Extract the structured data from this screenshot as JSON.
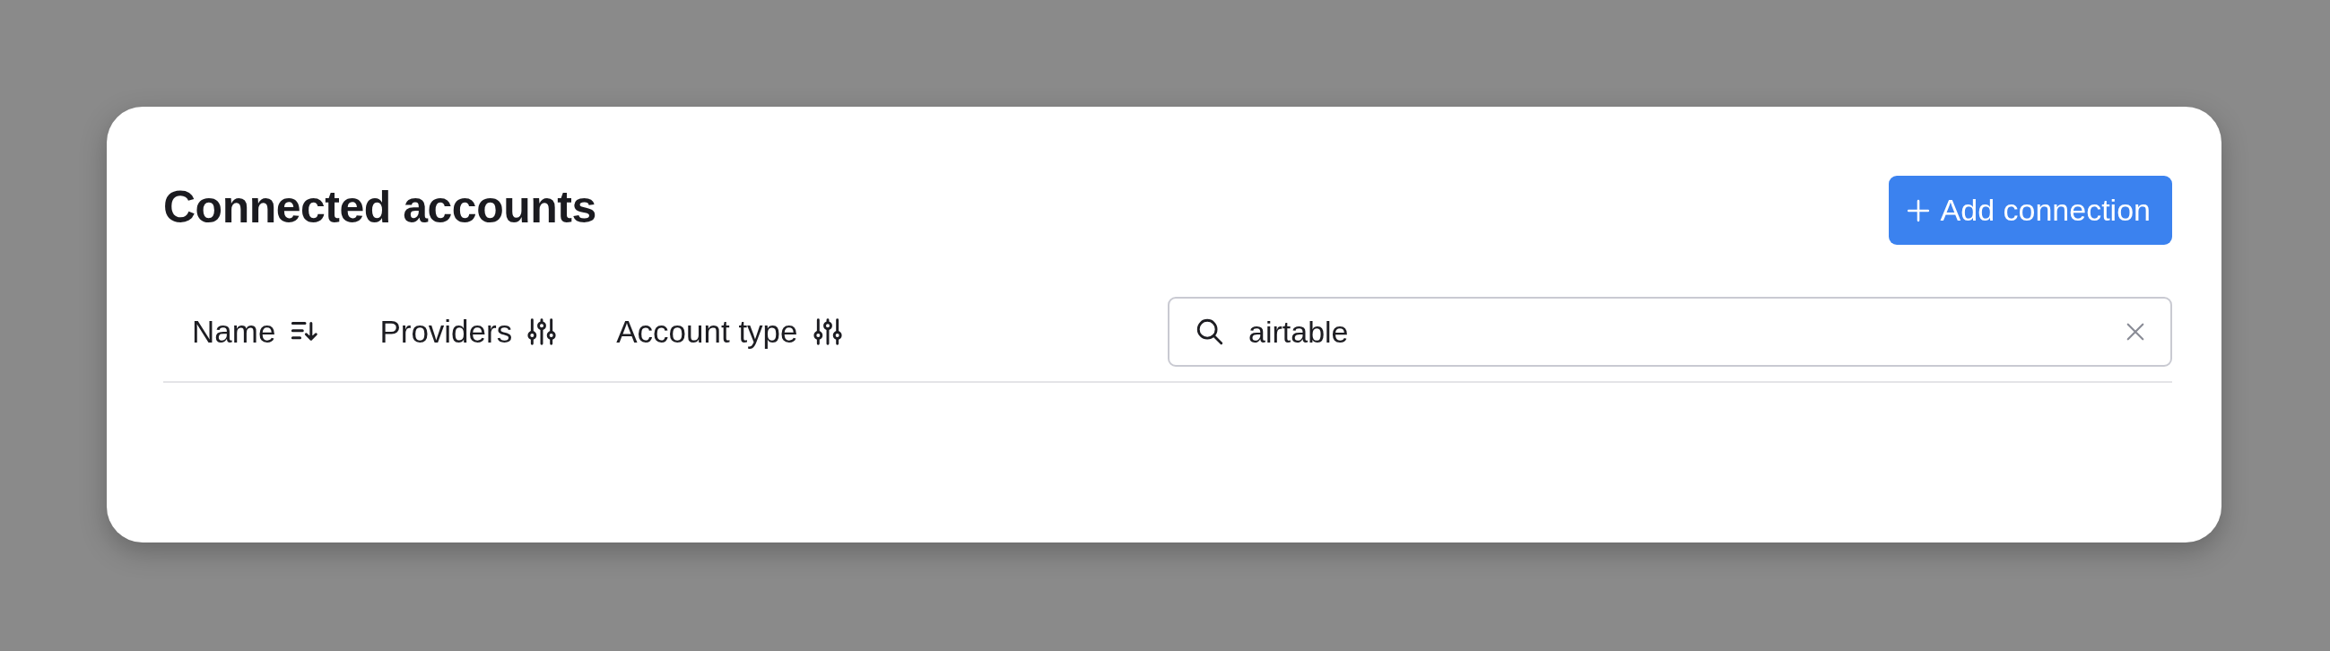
{
  "title": "Connected accounts",
  "add_button": {
    "label": "Add connection"
  },
  "columns": [
    {
      "label": "Name",
      "kind": "sort"
    },
    {
      "label": "Providers",
      "kind": "filter"
    },
    {
      "label": "Account type",
      "kind": "filter"
    }
  ],
  "search": {
    "value": "airtable"
  }
}
